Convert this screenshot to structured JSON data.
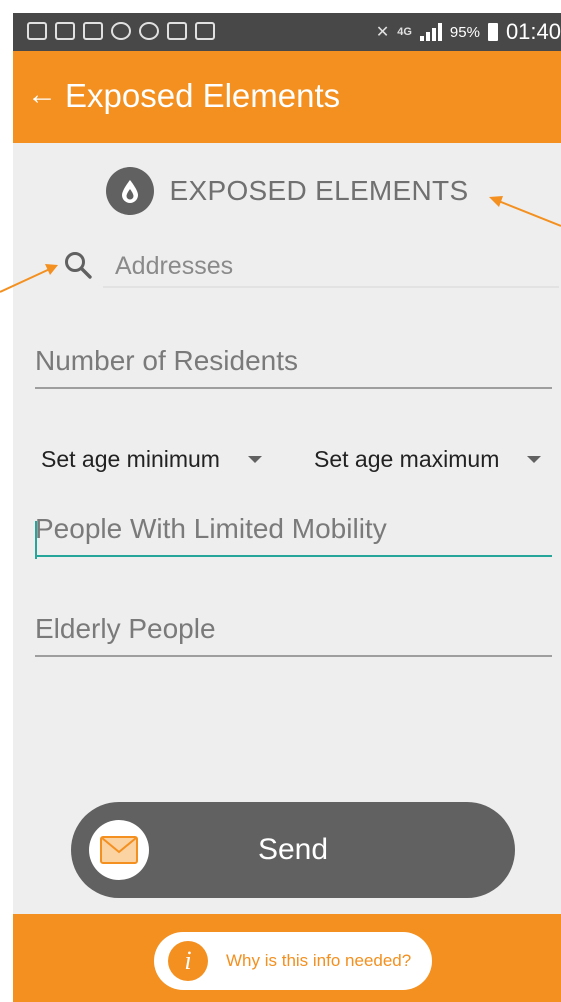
{
  "status_bar": {
    "battery": "95%",
    "network": "4G",
    "time": "01:40"
  },
  "app_bar": {
    "back_icon": "arrow-left-icon",
    "title": "Exposed Elements"
  },
  "section": {
    "icon": "water-drop-icon",
    "title": "EXPOSED ELEMENTS"
  },
  "form": {
    "search_placeholder": "Addresses",
    "residents_placeholder": "Number of Residents",
    "age_min_label": "Set age minimum",
    "age_max_label": "Set age maximum",
    "mobility_placeholder": "People With Limited Mobility",
    "elderly_placeholder": "Elderly People"
  },
  "send_button": {
    "icon": "envelope-icon",
    "label": "Send"
  },
  "info_button": {
    "icon": "info-icon",
    "glyph": "i",
    "label": "Why is this info needed?"
  },
  "colors": {
    "accent": "#f39020",
    "status_bar": "#484848",
    "button": "#616161",
    "focus": "#26a69a",
    "background": "#eeeeee"
  }
}
